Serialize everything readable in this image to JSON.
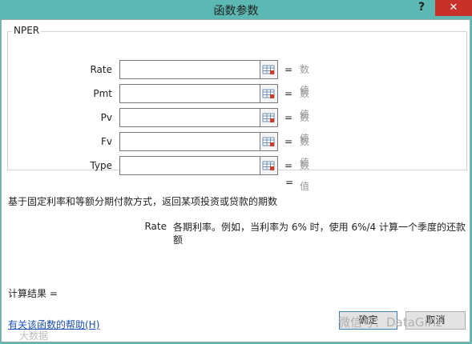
{
  "title": "函数参数",
  "controls": {
    "help": "?",
    "close": "✕"
  },
  "function_name": "NPER",
  "args": [
    {
      "label": "Rate",
      "value": "",
      "eq": "=",
      "result": "数值"
    },
    {
      "label": "Pmt",
      "value": "",
      "eq": "=",
      "result": "数值"
    },
    {
      "label": "Pv",
      "value": "",
      "eq": "=",
      "result": "数值"
    },
    {
      "label": "Fv",
      "value": "",
      "eq": "=",
      "result": "数值"
    },
    {
      "label": "Type",
      "value": "",
      "eq": "=",
      "result": "数值"
    }
  ],
  "result_eq": "=",
  "description": "基于固定利率和等额分期付款方式，返回某项投资或贷款的期数",
  "param_help": {
    "name": "Rate",
    "text": "各期利率。例如，当利率为 6% 时，使用 6%/4 计算一个季度的还款额"
  },
  "calc_result": "计算结果 =",
  "help_link": "有关该函数的帮助(H)",
  "buttons": {
    "ok": "确定",
    "cancel": "取消"
  },
  "watermarks": {
    "left": "大数据",
    "right": "微信号：DataGirlz"
  },
  "icons": {
    "ref_button": "range-select-icon"
  }
}
